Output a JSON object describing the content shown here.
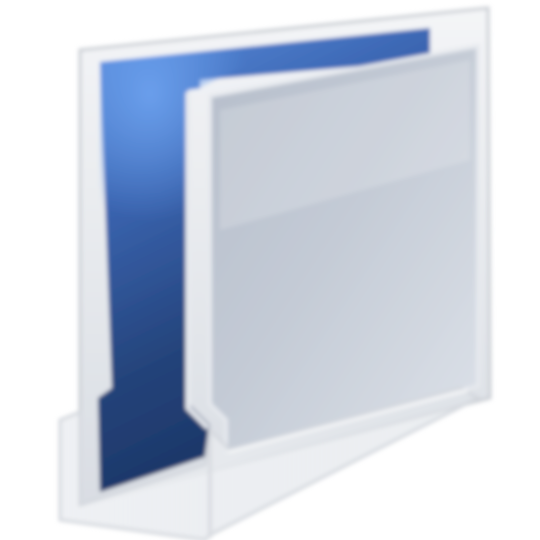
{
  "icon": {
    "name": "folder-icon",
    "style": "open-folder-blue-front-view",
    "colors": {
      "background": "#ffffff",
      "back_panel_light": "#5a8fe0",
      "back_panel_dark": "#1f3a6a",
      "front_panel_light": "#d4dae4",
      "front_panel_dark": "#9aa4b4",
      "frame": "#e3e6ea",
      "glass": "#f2f4f7"
    }
  }
}
